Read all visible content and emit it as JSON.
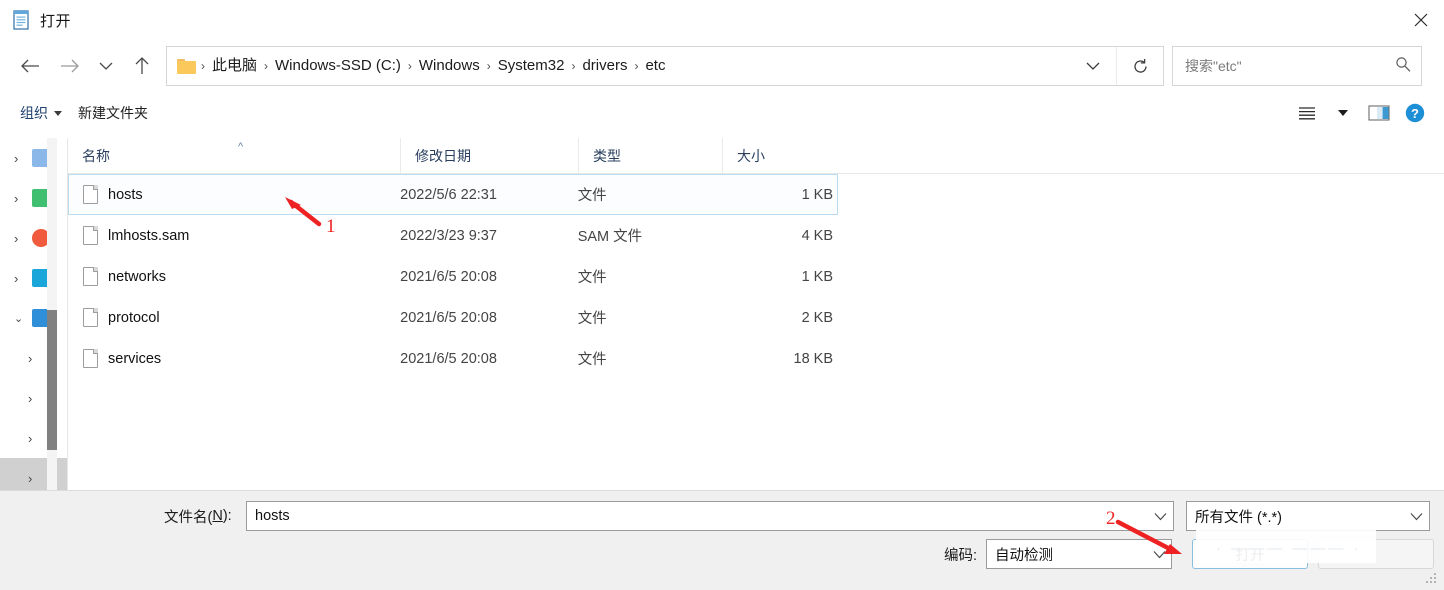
{
  "window": {
    "title": "打开",
    "title_icon": "notepad-icon",
    "close_icon": "close-icon"
  },
  "addressbar": {
    "back_icon": "arrow-left-icon",
    "forward_icon": "arrow-right-icon",
    "recent_icon": "chevron-down-icon",
    "up_icon": "arrow-up-icon",
    "folder_icon": "folder-icon",
    "separator": "›",
    "crumbs": [
      "此电脑",
      "Windows-SSD (C:)",
      "Windows",
      "System32",
      "drivers",
      "etc"
    ],
    "dropdown_icon": "chevron-down-icon",
    "refresh_icon": "refresh-icon",
    "search_placeholder": "搜索\"etc\"",
    "search_icon": "search-icon"
  },
  "commandbar": {
    "organize_label": "组织",
    "organize_caret": "caret-down-icon",
    "new_folder_label": "新建文件夹",
    "view_icon": "list-view-icon",
    "view_caret": "caret-down-icon",
    "preview_pane_icon": "preview-pane-icon",
    "help_icon": "help-icon"
  },
  "navpane": {
    "rows": [
      {
        "chevron": "›",
        "icon_color": "#8bb8e8",
        "indent": false,
        "selected": false
      },
      {
        "chevron": "›",
        "icon_color": "#3fbf6f",
        "indent": false,
        "selected": false
      },
      {
        "chevron": "›",
        "icon_color": "#ef5b3c",
        "indent": false,
        "selected": false
      },
      {
        "chevron": "›",
        "icon_color": "#1aa6d8",
        "indent": false,
        "selected": false
      },
      {
        "chevron": "⌄",
        "icon_color": "#2f8fd8",
        "indent": false,
        "selected": false
      },
      {
        "chevron": "›",
        "icon_color": "",
        "indent": true,
        "selected": false
      },
      {
        "chevron": "›",
        "icon_color": "",
        "indent": true,
        "selected": false
      },
      {
        "chevron": "›",
        "icon_color": "",
        "indent": true,
        "selected": false
      },
      {
        "chevron": "›",
        "icon_color": "",
        "indent": true,
        "selected": true
      },
      {
        "chevron": "›",
        "icon_color": "",
        "indent": true,
        "selected": false
      },
      {
        "chevron": "›",
        "icon_color": "#6b7a85",
        "indent": false,
        "selected": false
      }
    ]
  },
  "filelist": {
    "columns": [
      {
        "label": "名称",
        "key": "name"
      },
      {
        "label": "修改日期",
        "key": "date"
      },
      {
        "label": "类型",
        "key": "type"
      },
      {
        "label": "大小",
        "key": "size"
      }
    ],
    "sort_indicator": "^",
    "rows": [
      {
        "name": "hosts",
        "date": "2022/5/6 22:31",
        "type": "文件",
        "size": "1 KB",
        "selected": true,
        "icon": "file-icon"
      },
      {
        "name": "lmhosts.sam",
        "date": "2022/3/23 9:37",
        "type": "SAM 文件",
        "size": "4 KB",
        "selected": false,
        "icon": "file-icon"
      },
      {
        "name": "networks",
        "date": "2021/6/5 20:08",
        "type": "文件",
        "size": "1 KB",
        "selected": false,
        "icon": "file-icon"
      },
      {
        "name": "protocol",
        "date": "2021/6/5 20:08",
        "type": "文件",
        "size": "2 KB",
        "selected": false,
        "icon": "file-icon"
      },
      {
        "name": "services",
        "date": "2021/6/5 20:08",
        "type": "文件",
        "size": "18 KB",
        "selected": false,
        "icon": "file-icon"
      }
    ]
  },
  "bottom": {
    "filename_label": "文件名(N):",
    "filename_label_pre": "文件名(",
    "filename_label_key": "N",
    "filename_label_post": "):",
    "filename_value": "hosts",
    "filename_dropdown_icon": "chevron-down-icon",
    "filetype_value": "所有文件 (*.*)",
    "filetype_dropdown_icon": "chevron-down-icon",
    "encoding_label": "编码:",
    "encoding_value": "自动检测",
    "encoding_dropdown_icon": "chevron-down-icon",
    "open_button": "打开",
    "cancel_button": "",
    "watermark": "· ——— ——— ·"
  },
  "annotations": [
    {
      "number": "1",
      "color": "#ee2222"
    },
    {
      "number": "2",
      "color": "#ee2222"
    }
  ],
  "colors": {
    "accent": "#0078d7",
    "annotation_red": "#ee2222",
    "selection_border": "#b8dcf0",
    "header_text": "#2a3f5f"
  }
}
